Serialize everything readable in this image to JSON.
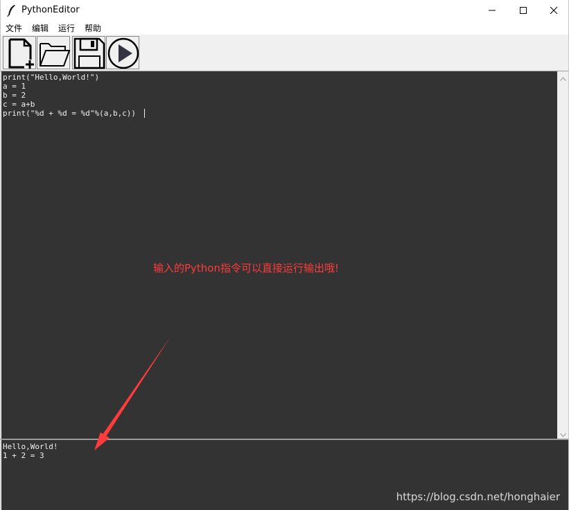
{
  "window": {
    "title": "PythonEditor",
    "app_icon": "feather-icon",
    "controls": [
      "minimize-icon",
      "maximize-icon",
      "close-icon"
    ]
  },
  "menu": {
    "items": [
      {
        "label": "文件"
      },
      {
        "label": "编辑"
      },
      {
        "label": "运行"
      },
      {
        "label": "帮助"
      }
    ]
  },
  "toolbar": {
    "buttons": [
      {
        "icon": "new-file-icon"
      },
      {
        "icon": "open-folder-icon"
      },
      {
        "icon": "save-icon"
      },
      {
        "icon": "run-icon"
      }
    ]
  },
  "editor": {
    "lines": [
      "print(\"Hello,World!\")",
      "a = 1",
      "b = 2",
      "c = a+b",
      "print(\"%d + %d = %d\"%(a,b,c))"
    ],
    "annotation": "输入的Python指令可以直接运行输出哦!"
  },
  "output": {
    "lines": [
      "Hello,World!",
      "1 + 2 = 3"
    ]
  },
  "watermark": "https://blog.csdn.net/honghaier",
  "colors": {
    "editor_bg": "#333333",
    "text": "#f0f0f0",
    "annotation": "#ff3b3b",
    "toolbar_bg": "#f0f0f0"
  }
}
